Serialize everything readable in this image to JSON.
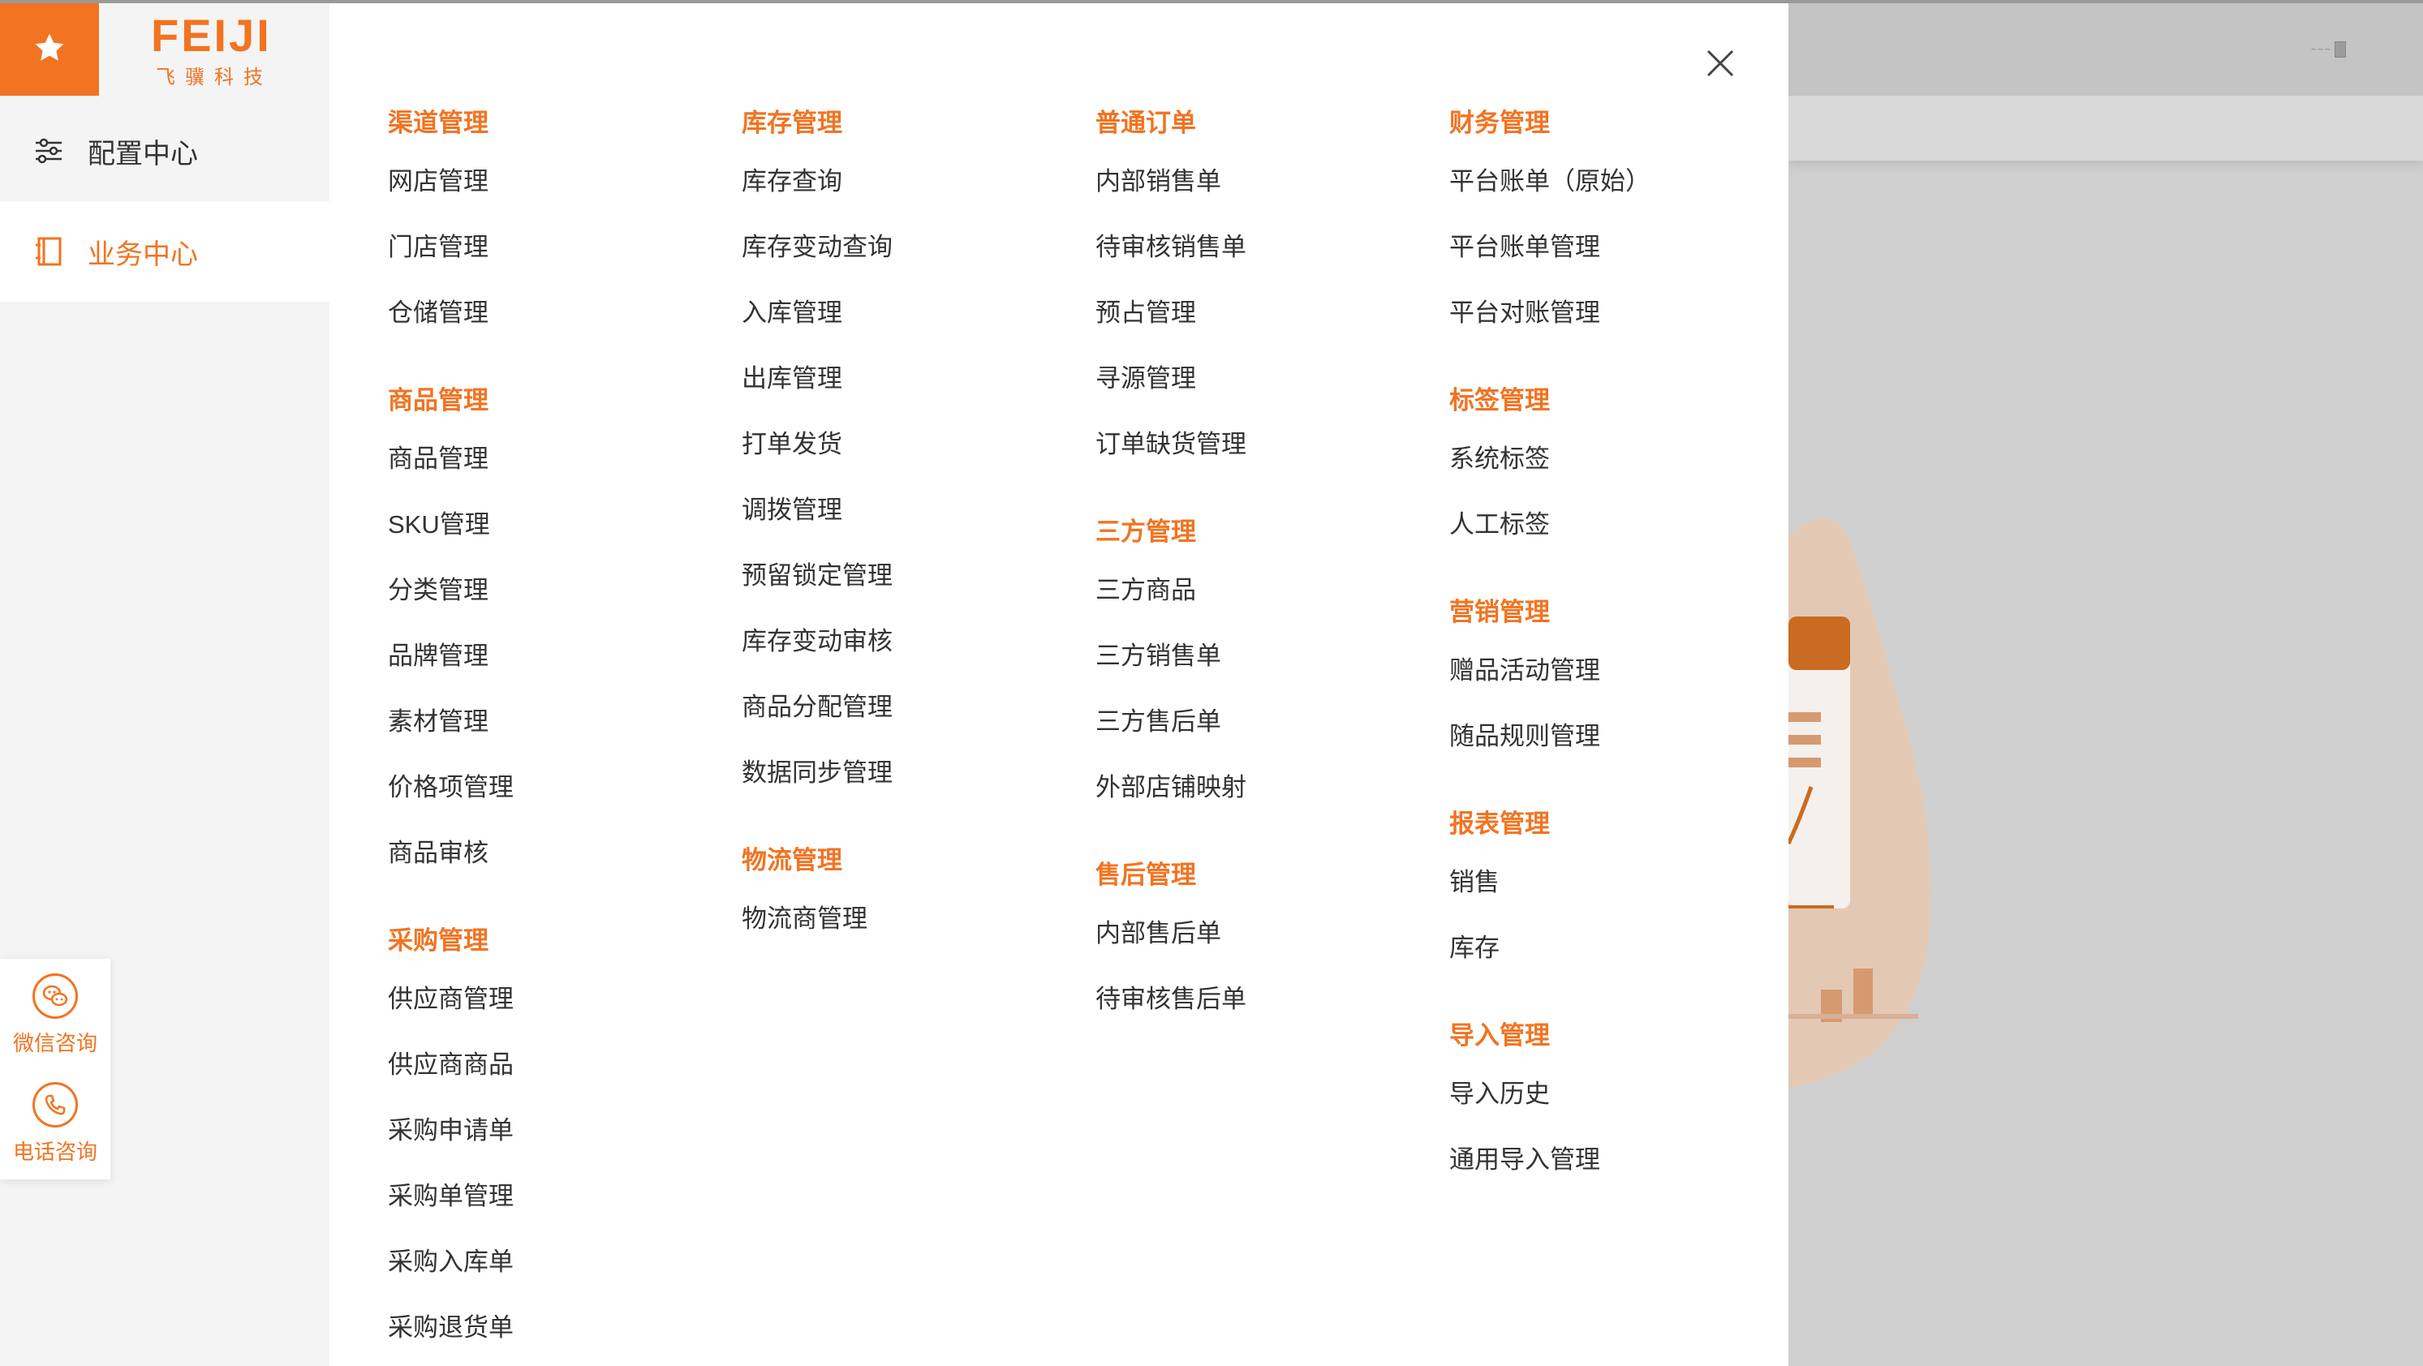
{
  "brand": {
    "name": "FEIJI",
    "subtitle": "飞骥科技",
    "accent_color": "#f27321",
    "logo_icon": "star-icon"
  },
  "sidebar": {
    "items": [
      {
        "label": "配置中心",
        "icon": "sliders-icon",
        "active": false
      },
      {
        "label": "业务中心",
        "icon": "notebook-icon",
        "active": true
      }
    ],
    "consult": [
      {
        "label": "微信咨询",
        "icon": "wechat-icon"
      },
      {
        "label": "电话咨询",
        "icon": "phone-icon"
      }
    ]
  },
  "header": {
    "user_text": "~ ~ ~"
  },
  "menu": {
    "close_icon": "close-icon",
    "columns": [
      {
        "groups": [
          {
            "title": "渠道管理",
            "items": [
              "网店管理",
              "门店管理",
              "仓储管理"
            ]
          },
          {
            "title": "商品管理",
            "items": [
              "商品管理",
              "SKU管理",
              "分类管理",
              "品牌管理",
              "素材管理",
              "价格项管理",
              "商品审核"
            ]
          },
          {
            "title": "采购管理",
            "items": [
              "供应商管理",
              "供应商商品",
              "采购申请单",
              "采购单管理",
              "采购入库单",
              "采购退货单"
            ]
          }
        ]
      },
      {
        "groups": [
          {
            "title": "库存管理",
            "items": [
              "库存查询",
              "库存变动查询",
              "入库管理",
              "出库管理",
              "打单发货",
              "调拨管理",
              "预留锁定管理",
              "库存变动审核",
              "商品分配管理",
              "数据同步管理"
            ]
          },
          {
            "title": "物流管理",
            "items": [
              "物流商管理"
            ]
          }
        ]
      },
      {
        "groups": [
          {
            "title": "普通订单",
            "items": [
              "内部销售单",
              "待审核销售单",
              "预占管理",
              "寻源管理",
              "订单缺货管理"
            ]
          },
          {
            "title": "三方管理",
            "items": [
              "三方商品",
              "三方销售单",
              "三方售后单",
              "外部店铺映射"
            ]
          },
          {
            "title": "售后管理",
            "items": [
              "内部售后单",
              "待审核售后单"
            ]
          }
        ]
      },
      {
        "groups": [
          {
            "title": "财务管理",
            "items": [
              "平台账单（原始）",
              "平台账单管理",
              "平台对账管理"
            ]
          },
          {
            "title": "标签管理",
            "items": [
              "系统标签",
              "人工标签"
            ]
          },
          {
            "title": "营销管理",
            "items": [
              "赠品活动管理",
              "随品规则管理"
            ]
          },
          {
            "title": "报表管理",
            "items": [
              "销售",
              "库存"
            ]
          },
          {
            "title": "导入管理",
            "items": [
              "导入历史",
              "通用导入管理"
            ]
          }
        ]
      }
    ]
  }
}
